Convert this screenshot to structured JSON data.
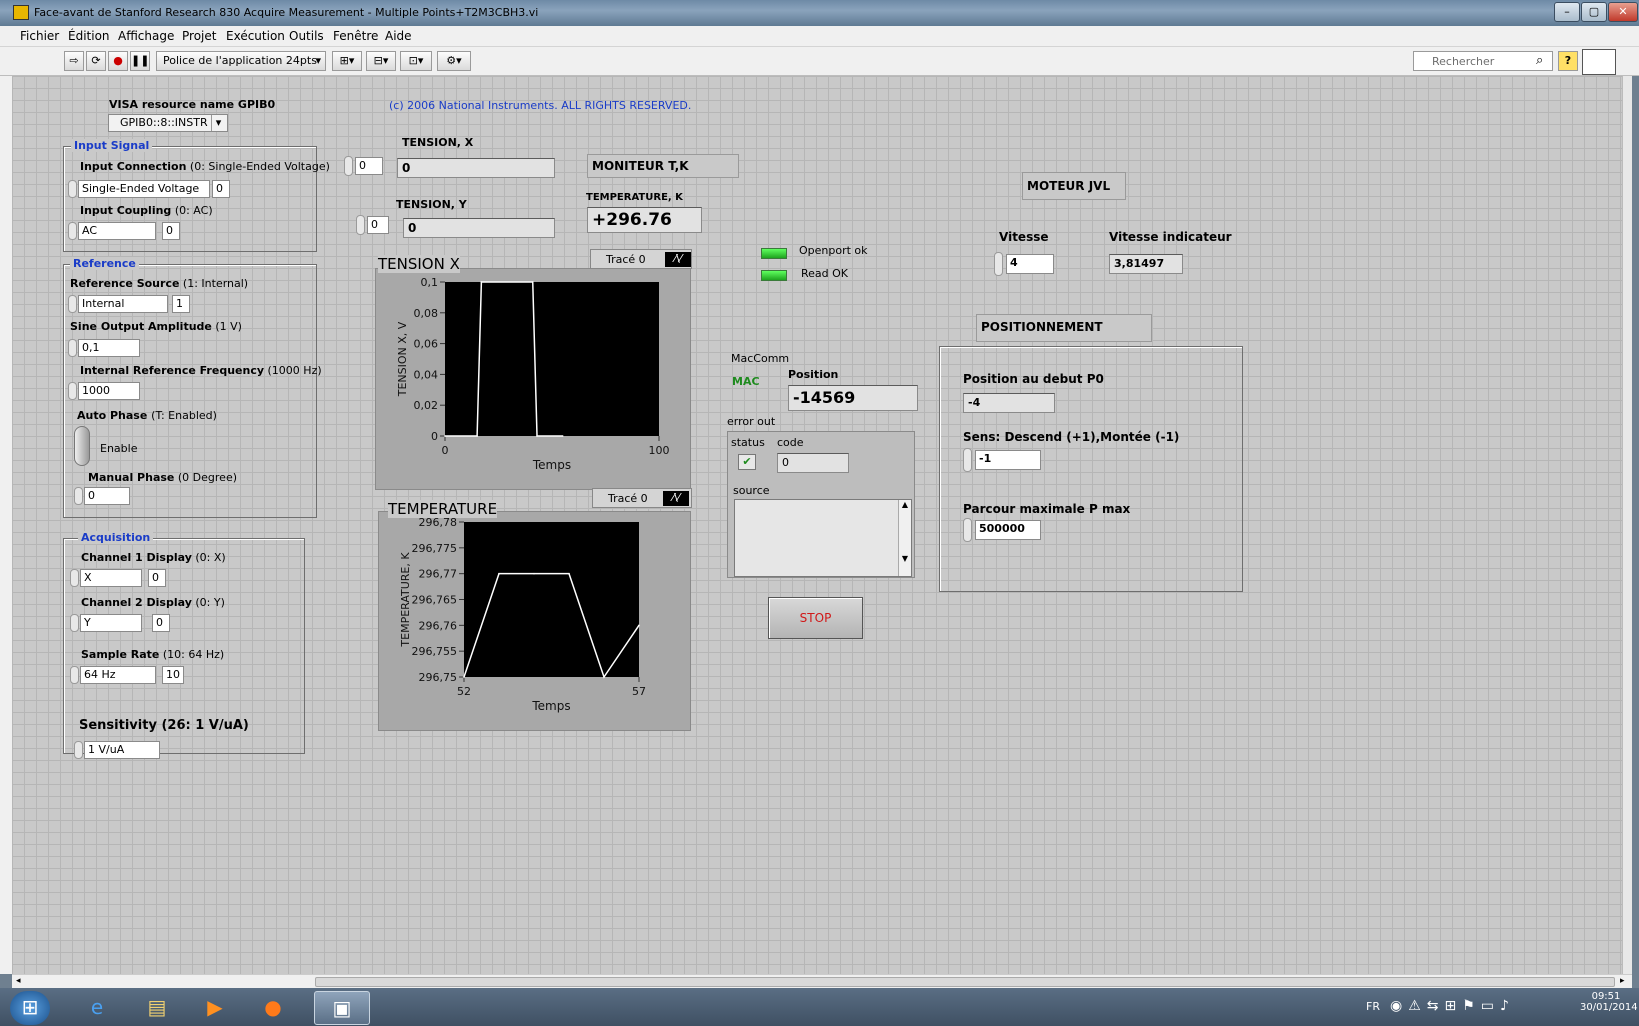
{
  "window": {
    "title": "Face-avant de Stanford Research 830 Acquire Measurement - Multiple Points+T2M3CBH3.vi",
    "min": "–",
    "max": "▢",
    "close": "✕"
  },
  "menu": [
    "Fichier",
    "Édition",
    "Affichage",
    "Projet",
    "Exécution",
    "Outils",
    "Fenêtre",
    "Aide"
  ],
  "toolbar": {
    "font": "Police de l'application 24pts",
    "search_placeholder": "Rechercher",
    "help": "?"
  },
  "visa": {
    "label": "VISA resource name GPIB0",
    "value": "GPIB0::8::INSTR"
  },
  "copyright": "(c) 2006 National Instruments.  ALL RIGHTS RESERVED.",
  "input_signal": {
    "title": "Input Signal",
    "conn_label": "Input Connection",
    "conn_hint": "(0: Single-Ended Voltage)",
    "conn_value": "Single-Ended Voltage",
    "conn_num": "0",
    "coup_label": "Input Coupling",
    "coup_hint": "(0: AC)",
    "coup_value": "AC",
    "coup_num": "0"
  },
  "reference": {
    "title": "Reference",
    "src_label": "Reference Source",
    "src_hint": "(1: Internal)",
    "src_value": "Internal",
    "src_num": "1",
    "amp_label": "Sine Output Amplitude",
    "amp_hint": "(1 V)",
    "amp_value": "0,1",
    "freq_label": "Internal Reference Frequency",
    "freq_hint": "(1000 Hz)",
    "freq_value": "1000",
    "auto_label": "Auto Phase",
    "auto_hint": "(T: Enabled)",
    "auto_value": "Enable",
    "man_label": "Manual Phase",
    "man_hint": "(0 Degree)",
    "man_value": "0"
  },
  "acquisition": {
    "title": "Acquisition",
    "ch1_label": "Channel 1 Display",
    "ch1_hint": "(0: X)",
    "ch1_value": "X",
    "ch1_num": "0",
    "ch2_label": "Channel 2 Display",
    "ch2_hint": "(0: Y)",
    "ch2_value": "Y",
    "ch2_num": "0",
    "rate_label": "Sample Rate",
    "rate_hint": "(10: 64 Hz)",
    "rate_value": "64 Hz",
    "rate_num": "10",
    "sens_label": "Sensitivity",
    "sens_hint": "(26: 1 V/uA)",
    "sens_value": "1 V/uA"
  },
  "tension": {
    "x_label": "TENSION, X",
    "x_idx": "0",
    "x_value": "0",
    "y_label": "TENSION, Y",
    "y_idx": "0",
    "y_value": "0"
  },
  "moniteur": {
    "title": "MONITEUR  T,K",
    "temp_label": "TEMPERATURE, K",
    "temp_value": "+296.76"
  },
  "leds": {
    "openport": "Openport ok",
    "read": "Read OK"
  },
  "chart_data": [
    {
      "type": "line",
      "title": "TENSION X",
      "legend": "Tracé 0",
      "xlabel": "Temps",
      "ylabel": "TENSION X, V",
      "xlim": [
        0,
        100
      ],
      "ylim": [
        0,
        0.1
      ],
      "xticks": [
        "0",
        "100"
      ],
      "yticks": [
        "0",
        "0,02",
        "0,04",
        "0,06",
        "0,08",
        "0,1"
      ],
      "x": [
        0,
        15,
        17,
        41,
        43,
        55
      ],
      "y": [
        0,
        0,
        0.1,
        0.1,
        0,
        0
      ]
    },
    {
      "type": "line",
      "title": "TEMPERATURE",
      "legend": "Tracé 0",
      "xlabel": "Temps",
      "ylabel": "TEMPERATURE, K",
      "xlim": [
        52,
        57
      ],
      "ylim": [
        296.75,
        296.78
      ],
      "xticks": [
        "52",
        "57"
      ],
      "yticks": [
        "296,75",
        "296,755",
        "296,76",
        "296,765",
        "296,77",
        "296,775",
        "296,78"
      ],
      "x": [
        52,
        53,
        54,
        55,
        56,
        57
      ],
      "y": [
        296.75,
        296.77,
        296.77,
        296.77,
        296.75,
        296.76
      ]
    }
  ],
  "maccomm": {
    "label": "MacComm",
    "mac": "MAC",
    "pos_label": "Position",
    "pos_value": "-14569"
  },
  "error_out": {
    "label": "error out",
    "status_label": "status",
    "code_label": "code",
    "code_value": "0",
    "source_label": "source",
    "check": "✔"
  },
  "stop": "STOP",
  "moteur": {
    "title": "MOTEUR JVL",
    "vit_label": "Vitesse",
    "vit_value": "4",
    "vind_label": "Vitesse indicateur",
    "vind_value": "3,81497"
  },
  "position": {
    "title": "POSITIONNEMENT",
    "p0_label": "Position au debut P0",
    "p0_value": "-4",
    "sens_label": "Sens: Descend (+1),Montée (-1)",
    "sens_value": "-1",
    "pmax_label": "Parcour maximale P max",
    "pmax_value": "500000"
  },
  "taskbar": {
    "lang": "FR",
    "time": "09:51",
    "date": "30/01/2014"
  }
}
